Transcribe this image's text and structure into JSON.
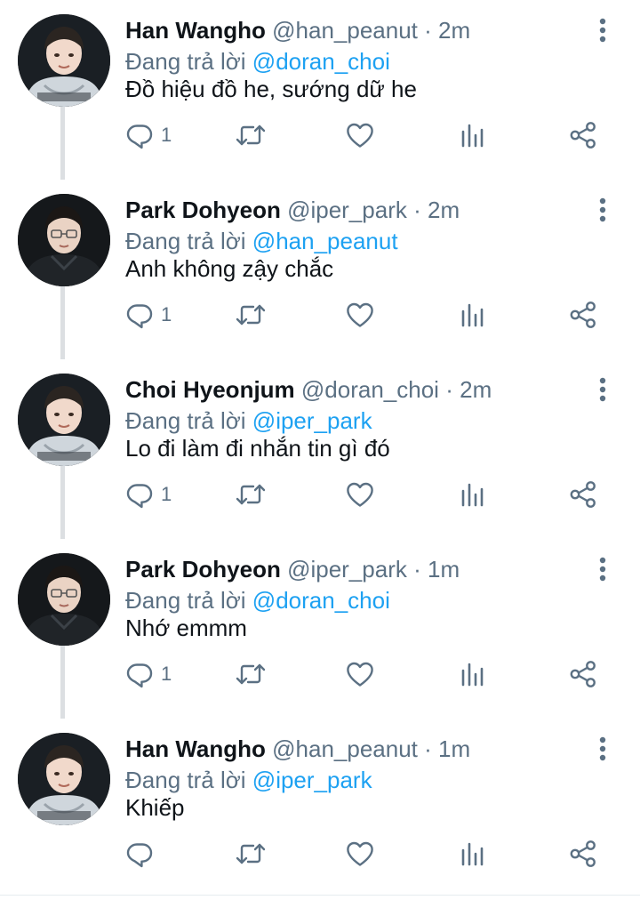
{
  "thread": [
    {
      "name": "Han Wangho",
      "handle": "@han_peanut",
      "separator": "·",
      "time": "2m",
      "replying_prefix": "Đang trả lời",
      "replying_to": "@doran_choi",
      "text": "Đồ hiệu đồ he, sướng dữ he",
      "reply_count": "1",
      "avatar_style": "light"
    },
    {
      "name": "Park Dohyeon",
      "handle": "@iper_park",
      "separator": "·",
      "time": "2m",
      "replying_prefix": "Đang trả lời",
      "replying_to": "@han_peanut",
      "text": "Anh không zậy chắc",
      "reply_count": "1",
      "avatar_style": "dark"
    },
    {
      "name": "Choi Hyeonjum",
      "handle": "@doran_choi",
      "separator": "·",
      "time": "2m",
      "replying_prefix": "Đang trả lời",
      "replying_to": "@iper_park",
      "text": "Lo đi làm đi nhắn tin gì đó",
      "reply_count": "1",
      "avatar_style": "light"
    },
    {
      "name": "Park Dohyeon",
      "handle": "@iper_park",
      "separator": "·",
      "time": "1m",
      "replying_prefix": "Đang trả lời",
      "replying_to": "@doran_choi",
      "text": "Nhớ emmm",
      "reply_count": "1",
      "avatar_style": "dark"
    },
    {
      "name": "Han Wangho",
      "handle": "@han_peanut",
      "separator": "·",
      "time": "1m",
      "replying_prefix": "Đang trả lời",
      "replying_to": "@iper_park",
      "text": "Khiếp",
      "reply_count": "",
      "avatar_style": "light"
    }
  ],
  "icons": {
    "reply": "reply-icon",
    "retweet": "retweet-icon",
    "like": "like-icon",
    "stats": "stats-icon",
    "share": "share-icon",
    "more": "more-vertical-icon"
  },
  "colors": {
    "text": "#0f1419",
    "secondary": "#5b7083",
    "mention": "#1da1f2",
    "thread_line": "#dcdfe2",
    "background": "#ffffff"
  }
}
